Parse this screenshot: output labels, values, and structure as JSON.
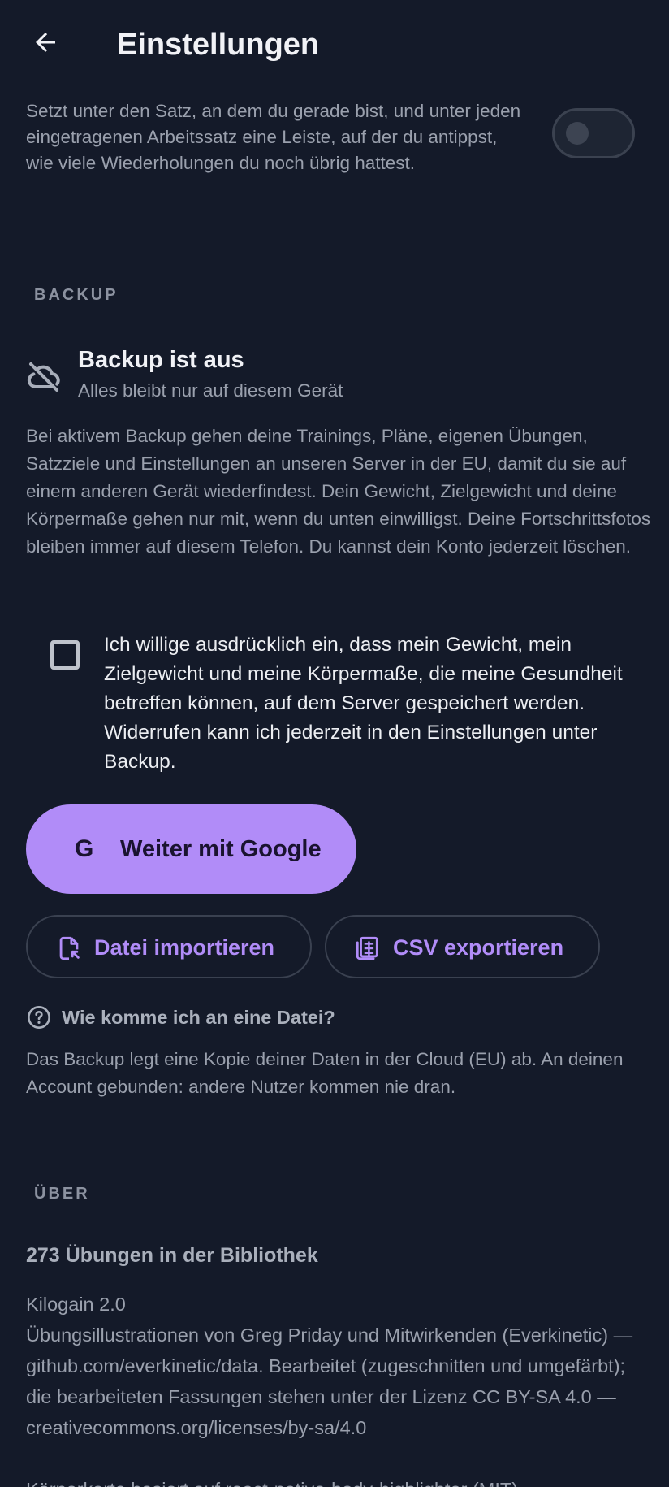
{
  "header": {
    "title": "Einstellungen"
  },
  "rir_setting": {
    "description": "Setzt unter den Satz, an dem du gerade bist, und unter jeden eingetragenen Arbeitssatz eine Leiste, auf der du antippst, wie viele Wiederholungen du noch übrig hattest.",
    "toggle_on": false
  },
  "backup": {
    "section_label": "BACKUP",
    "status_title": "Backup ist aus",
    "status_subtitle": "Alles bleibt nur auf diesem Gerät",
    "description": "Bei aktivem Backup gehen deine Trainings, Pläne, eigenen Übungen, Satzziele und Einstellungen an unseren Server in der EU, damit du sie auf einem anderen Gerät wiederfindest. Dein Gewicht, Zielgewicht und deine Körpermaße gehen nur mit, wenn du unten einwilligst. Deine Fortschrittsfotos bleiben immer auf diesem Telefon. Du kannst dein Konto jederzeit löschen.",
    "consent_label": "Ich willige ausdrücklich ein, dass mein Gewicht, mein Zielgewicht und meine Körpermaße, die meine Gesundheit betreffen können, auf dem Server gespeichert werden. Widerrufen kann ich jederzeit in den Einstellungen unter Backup.",
    "consent_checked": false,
    "google_icon_letter": "G",
    "google_button": "Weiter mit Google",
    "import_button": "Datei importieren",
    "export_button": "CSV exportieren",
    "help_link": "Wie komme ich an eine Datei?",
    "footnote": "Das Backup legt eine Kopie deiner Daten in der Cloud (EU) ab. An deinen Account gebunden: andere Nutzer kommen nie dran."
  },
  "about": {
    "section_label": "ÜBER",
    "library_count": "273 Übungen in der Bibliothek",
    "app_version": "Kilogain 2.0",
    "credits": "Übungsillustrationen von Greg Priday und Mitwirkenden (Everkinetic) — github.com/everkinetic/data. Bearbeitet (zugeschnitten und umgefärbt); die bearbeiteten Fassungen stehen unter der Lizenz CC BY-SA 4.0 — creativecommons.org/licenses/by-sa/4.0",
    "body_map_credit": "Körperkarte basiert auf react-native-body-highlighter (MIT)"
  },
  "colors": {
    "background": "#141a29",
    "accent": "#b18cf8",
    "text_primary": "#f1f2f6",
    "text_secondary": "#9aa0ad"
  },
  "icons": {
    "back": "arrow-left-icon",
    "backup_status": "cloud-off-icon",
    "import": "file-import-icon",
    "export": "spreadsheet-icon",
    "help": "question-circle-icon"
  }
}
